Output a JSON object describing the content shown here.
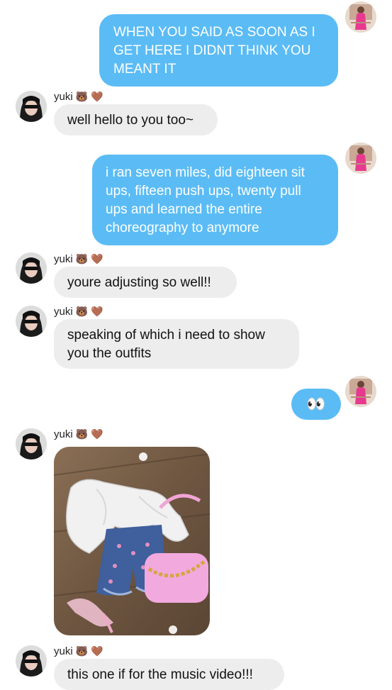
{
  "chat": {
    "sender_name": "yuki",
    "name_emoji_1": "🐻",
    "name_emoji_2": "🤎",
    "messages": [
      {
        "text": "WHEN YOU SAID AS SOON AS I GET HERE I DIDNT THINK YOU MEANT IT"
      },
      {
        "text": "well hello to you too~"
      },
      {
        "text": "i ran seven miles, did eighteen sit ups, fifteen push ups, twenty pull ups and learned the entire choreography to anymore"
      },
      {
        "text": "youre adjusting so well!!"
      },
      {
        "text": "speaking of which i need to show you the outfits"
      },
      {
        "text": "👀"
      },
      {
        "text": "this one if for the music video!!!"
      }
    ]
  },
  "icons": {
    "my_avatar": "avatar-pink-dress",
    "their_avatar": "avatar-dark-hair-sunglasses",
    "photo": "outfit-photo"
  },
  "colors": {
    "outgoing_bubble": "#5bbcf5",
    "incoming_bubble": "#ededed"
  }
}
